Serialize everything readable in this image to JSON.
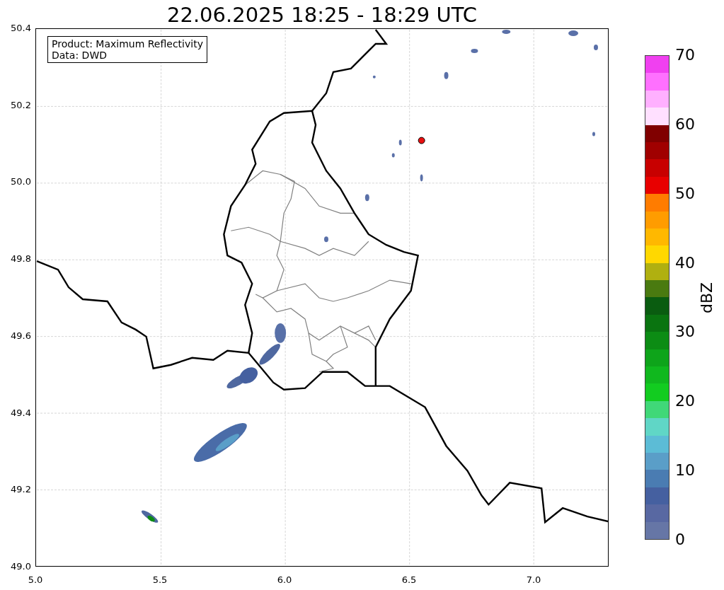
{
  "title": "22.06.2025 18:25 - 18:29 UTC",
  "map": {
    "info_box": [
      "Product: Maximum Reflectivity",
      "Data: DWD"
    ],
    "y_ticks": [
      "50.4",
      "50.2",
      "50.0",
      "49.8",
      "49.6",
      "49.4",
      "49.2",
      "49.0"
    ],
    "x_ticks": [
      "5.0",
      "5.5",
      "6.0",
      "6.5",
      "7.0"
    ]
  },
  "colorbar": {
    "label": "dBZ",
    "ticks": [
      "70",
      "60",
      "50",
      "40",
      "30",
      "20",
      "10",
      "0"
    ],
    "bands": [
      {
        "color": "#f040f0"
      },
      {
        "color": "#ff70ff"
      },
      {
        "color": "#ffb0ff"
      },
      {
        "color": "#ffe0ff"
      },
      {
        "color": "#800000"
      },
      {
        "color": "#a00000"
      },
      {
        "color": "#c80000"
      },
      {
        "color": "#e80000"
      },
      {
        "color": "#ff7c00"
      },
      {
        "color": "#ff9c00"
      },
      {
        "color": "#ffb800"
      },
      {
        "color": "#ffd800"
      },
      {
        "color": "#b0b010"
      },
      {
        "color": "#4a7a10"
      },
      {
        "color": "#0a5c10"
      },
      {
        "color": "#0a7410"
      },
      {
        "color": "#0c8c14"
      },
      {
        "color": "#0ea41a"
      },
      {
        "color": "#10b81e"
      },
      {
        "color": "#12cc20"
      },
      {
        "color": "#40d878"
      },
      {
        "color": "#60d6c6"
      },
      {
        "color": "#5cbcd6"
      },
      {
        "color": "#5a9ec8"
      },
      {
        "color": "#4a7cb2"
      },
      {
        "color": "#4560a0"
      },
      {
        "color": "#5868a2"
      },
      {
        "color": "#6676a6"
      }
    ]
  }
}
